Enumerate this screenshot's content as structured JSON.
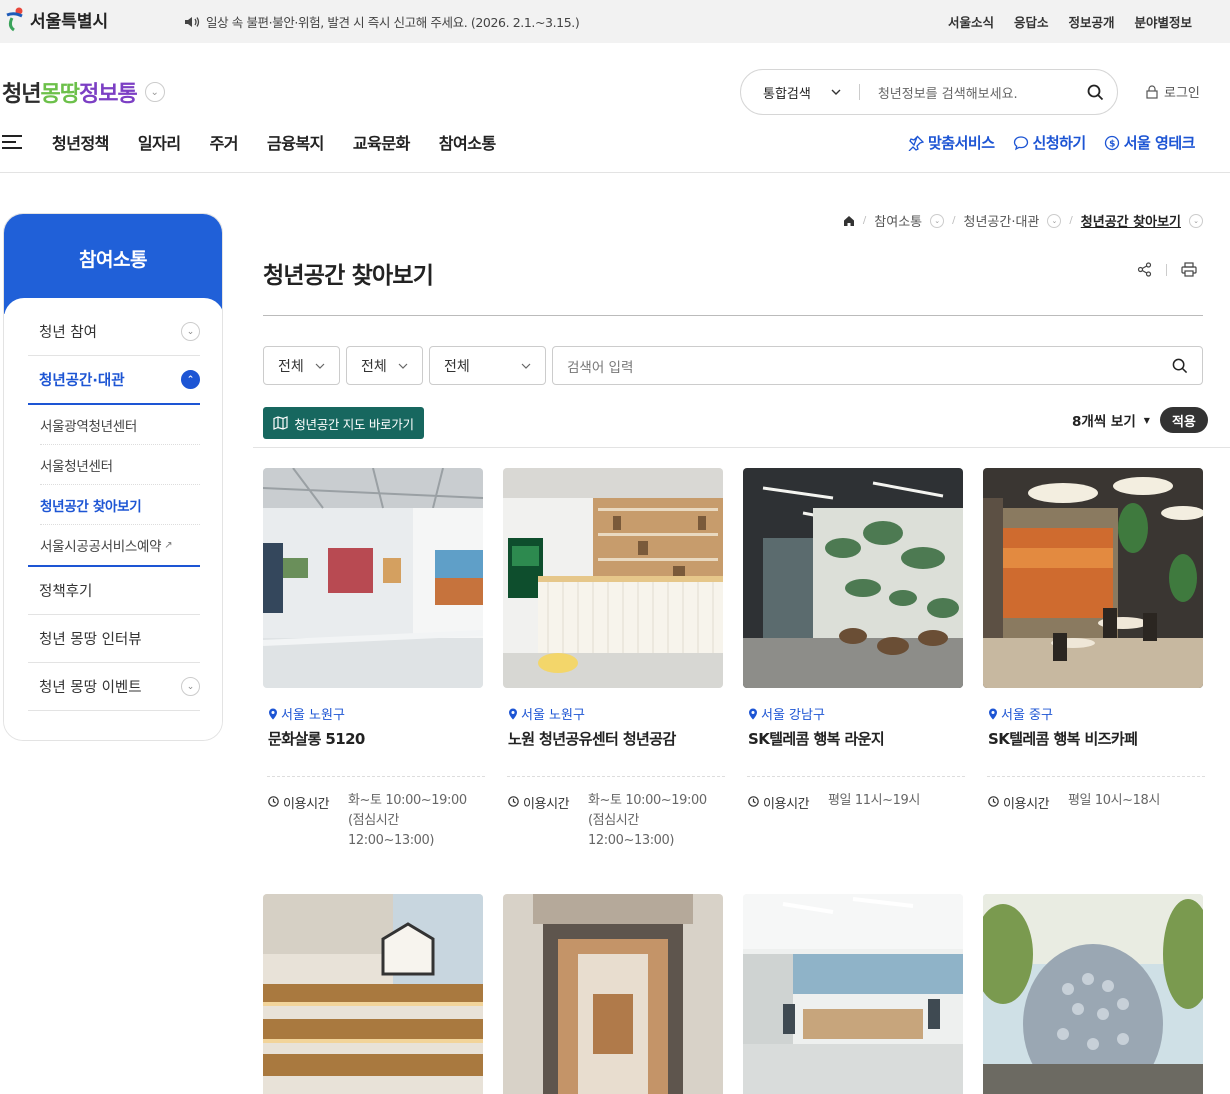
{
  "topbar": {
    "site_name": "서울특별시",
    "notice": "일상 속 불편·불안·위험, 발견 시 즉시 신고해 주세요. (2026. 2.1.~3.15.)",
    "links": [
      "서울소식",
      "응답소",
      "정보공개",
      "분야별정보"
    ]
  },
  "header": {
    "logo": {
      "part1": "청년",
      "part2": "몽땅",
      "part3": "정보통"
    },
    "search": {
      "scope": "통합검색",
      "placeholder": "청년정보를 검색해보세요."
    },
    "login": "로그인",
    "gnb": [
      "청년정책",
      "일자리",
      "주거",
      "금융복지",
      "교육문화",
      "참여소통"
    ],
    "quick": [
      "맞춤서비스",
      "신청하기",
      "서울 영테크"
    ]
  },
  "sidebar": {
    "title": "참여소통",
    "items": [
      {
        "label": "청년 참여"
      },
      {
        "label": "청년공간·대관"
      },
      {
        "label": "정책후기"
      },
      {
        "label": "청년 몽땅 인터뷰"
      },
      {
        "label": "청년 몽땅 이벤트"
      }
    ],
    "sub_items": [
      "서울광역청년센터",
      "서울청년센터",
      "청년공간 찾아보기",
      "서울시공공서비스예약"
    ]
  },
  "breadcrumb": [
    "참여소통",
    "청년공간·대관",
    "청년공간 찾아보기"
  ],
  "page": {
    "title": "청년공간 찾아보기",
    "filters": [
      "전체",
      "전체",
      "전체"
    ],
    "keyword_placeholder": "검색어 입력",
    "map_button": "청년공간 지도 바로가기",
    "per_page": "8개씩 보기",
    "apply": "적용"
  },
  "cards": [
    {
      "location": "서울 노원구",
      "name": "문화살롱 5120",
      "hours_label": "이용시간",
      "hours": "화~토 10:00~19:00 (점심시간 12:00~13:00)"
    },
    {
      "location": "서울 노원구",
      "name": "노원 청년공유센터 청년공감",
      "hours_label": "이용시간",
      "hours": "화~토 10:00~19:00 (점심시간 12:00~13:00)"
    },
    {
      "location": "서울 강남구",
      "name": "SK텔레콤 행복 라운지",
      "hours_label": "이용시간",
      "hours": "평일 11시~19시"
    },
    {
      "location": "서울 중구",
      "name": "SK텔레콤 행복 비즈카페",
      "hours_label": "이용시간",
      "hours": "평일 10시~18시"
    }
  ],
  "colors": {
    "brand_blue": "#2060d8",
    "map_button": "#17675f"
  }
}
